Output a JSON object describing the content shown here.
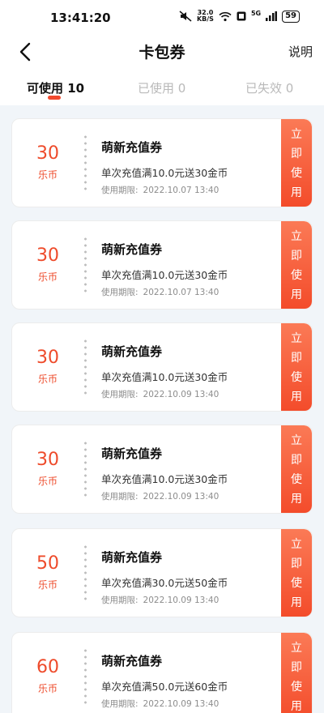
{
  "status_bar": {
    "time": "13:41:20",
    "net_speed_value": "32.0",
    "net_speed_unit": "KB/S",
    "signal_label": "5G",
    "battery": "59"
  },
  "header": {
    "title": "卡包券",
    "help_label": "说明"
  },
  "tabs": [
    {
      "label": "可使用 10",
      "active": true
    },
    {
      "label": "已使用 0",
      "active": false
    },
    {
      "label": "已失效 0",
      "active": false
    }
  ],
  "colors": {
    "accent": "#f24a2e",
    "amount": "#ee4b2b",
    "background": "#f1f5f9"
  },
  "coupons": [
    {
      "amount": "30",
      "unit": "乐币",
      "title": "萌新充值券",
      "description": "单次充值满10.0元送30金币",
      "expiry_label": "使用期限:",
      "expiry": "2022.10.07 13:40",
      "button": [
        "立",
        "即",
        "使",
        "用"
      ]
    },
    {
      "amount": "30",
      "unit": "乐币",
      "title": "萌新充值券",
      "description": "单次充值满10.0元送30金币",
      "expiry_label": "使用期限:",
      "expiry": "2022.10.07 13:40",
      "button": [
        "立",
        "即",
        "使",
        "用"
      ]
    },
    {
      "amount": "30",
      "unit": "乐币",
      "title": "萌新充值券",
      "description": "单次充值满10.0元送30金币",
      "expiry_label": "使用期限:",
      "expiry": "2022.10.09 13:40",
      "button": [
        "立",
        "即",
        "使",
        "用"
      ]
    },
    {
      "amount": "30",
      "unit": "乐币",
      "title": "萌新充值券",
      "description": "单次充值满10.0元送30金币",
      "expiry_label": "使用期限:",
      "expiry": "2022.10.09 13:40",
      "button": [
        "立",
        "即",
        "使",
        "用"
      ]
    },
    {
      "amount": "50",
      "unit": "乐币",
      "title": "萌新充值券",
      "description": "单次充值满30.0元送50金币",
      "expiry_label": "使用期限:",
      "expiry": "2022.10.09 13:40",
      "button": [
        "立",
        "即",
        "使",
        "用"
      ]
    },
    {
      "amount": "60",
      "unit": "乐币",
      "title": "萌新充值券",
      "description": "单次充值满50.0元送60金币",
      "expiry_label": "使用期限:",
      "expiry": "2022.10.09 13:40",
      "button": [
        "立",
        "即",
        "使",
        "用"
      ]
    }
  ]
}
